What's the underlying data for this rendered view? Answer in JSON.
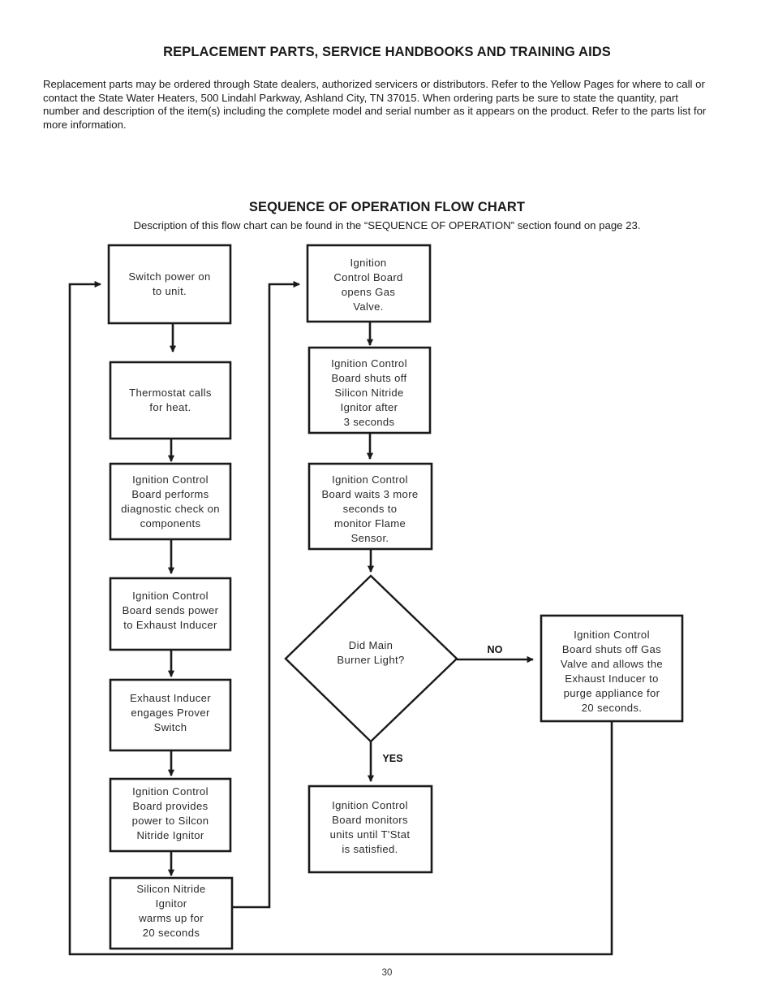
{
  "document": {
    "page_number": "30"
  },
  "parts_section": {
    "heading": "REPLACEMENT PARTS, SERVICE HANDBOOKS AND TRAINING AIDS",
    "paragraph": "Replacement parts may be ordered through State dealers, authorized servicers or distributors.  Refer to the Yellow Pages for where to call or contact the State Water Heaters, 500 Lindahl Parkway, Ashland City, TN 37015. When ordering parts be sure to state the quantity, part number and description of the item(s) including the complete model and serial number as it appears on the product. Refer to the parts list for more information."
  },
  "flow_section": {
    "heading": "SEQUENCE OF OPERATION FLOW CHART",
    "subheading": "Description of this flow chart can be found in the “SEQUENCE OF OPERATION” section found on page 23."
  },
  "chart_data": {
    "type": "diagram",
    "title": "SEQUENCE OF OPERATION FLOW CHART",
    "nodes": [
      {
        "id": "n1",
        "shape": "process",
        "lines": [
          "Switch power on",
          "to unit."
        ]
      },
      {
        "id": "n2",
        "shape": "process",
        "lines": [
          "Thermostat calls",
          "for heat."
        ]
      },
      {
        "id": "n3",
        "shape": "process",
        "lines": [
          "Ignition Control",
          "Board performs",
          "diagnostic check on",
          "components"
        ]
      },
      {
        "id": "n4",
        "shape": "process",
        "lines": [
          "Ignition Control",
          "Board sends power",
          "to Exhaust Inducer"
        ]
      },
      {
        "id": "n5",
        "shape": "process",
        "lines": [
          "Exhaust Inducer",
          "engages Prover",
          "Switch"
        ]
      },
      {
        "id": "n6",
        "shape": "process",
        "lines": [
          "Ignition Control",
          "Board provides",
          "power to Silcon",
          "Nitride Ignitor"
        ]
      },
      {
        "id": "n7",
        "shape": "process",
        "lines": [
          "Silicon Nitride",
          "Ignitor",
          "warms up for",
          "20 seconds"
        ]
      },
      {
        "id": "n8",
        "shape": "process",
        "lines": [
          "Ignition",
          "Control Board",
          "opens Gas",
          "Valve."
        ]
      },
      {
        "id": "n9",
        "shape": "process",
        "lines": [
          "Ignition Control",
          "Board shuts off",
          "Silicon Nitride",
          "Ignitor after",
          "3 seconds"
        ]
      },
      {
        "id": "n10",
        "shape": "process",
        "lines": [
          "Ignition Control",
          "Board waits 3 more",
          "seconds to",
          "monitor Flame",
          "Sensor."
        ]
      },
      {
        "id": "n11",
        "shape": "decision",
        "lines": [
          "Did Main",
          "Burner Light?"
        ]
      },
      {
        "id": "n12",
        "shape": "process",
        "lines": [
          "Ignition Control",
          "Board shuts off Gas",
          "Valve and allows the",
          "Exhaust Inducer to",
          "purge appliance for",
          "20 seconds."
        ]
      },
      {
        "id": "n13",
        "shape": "process",
        "lines": [
          "Ignition Control",
          "Board monitors",
          "units until T'Stat",
          "is satisfied."
        ]
      }
    ],
    "edges": [
      {
        "from": "n1",
        "to": "n2",
        "label": ""
      },
      {
        "from": "n2",
        "to": "n3",
        "label": ""
      },
      {
        "from": "n3",
        "to": "n4",
        "label": ""
      },
      {
        "from": "n4",
        "to": "n5",
        "label": ""
      },
      {
        "from": "n5",
        "to": "n6",
        "label": ""
      },
      {
        "from": "n6",
        "to": "n7",
        "label": ""
      },
      {
        "from": "n7",
        "to": "n8",
        "label": ""
      },
      {
        "from": "n8",
        "to": "n9",
        "label": ""
      },
      {
        "from": "n9",
        "to": "n10",
        "label": ""
      },
      {
        "from": "n10",
        "to": "n11",
        "label": ""
      },
      {
        "from": "n11",
        "to": "n12",
        "label": "NO"
      },
      {
        "from": "n11",
        "to": "n13",
        "label": "YES"
      },
      {
        "from": "n12",
        "to": "n1",
        "label": ""
      }
    ],
    "branch_labels": {
      "no": "NO",
      "yes": "YES"
    }
  }
}
